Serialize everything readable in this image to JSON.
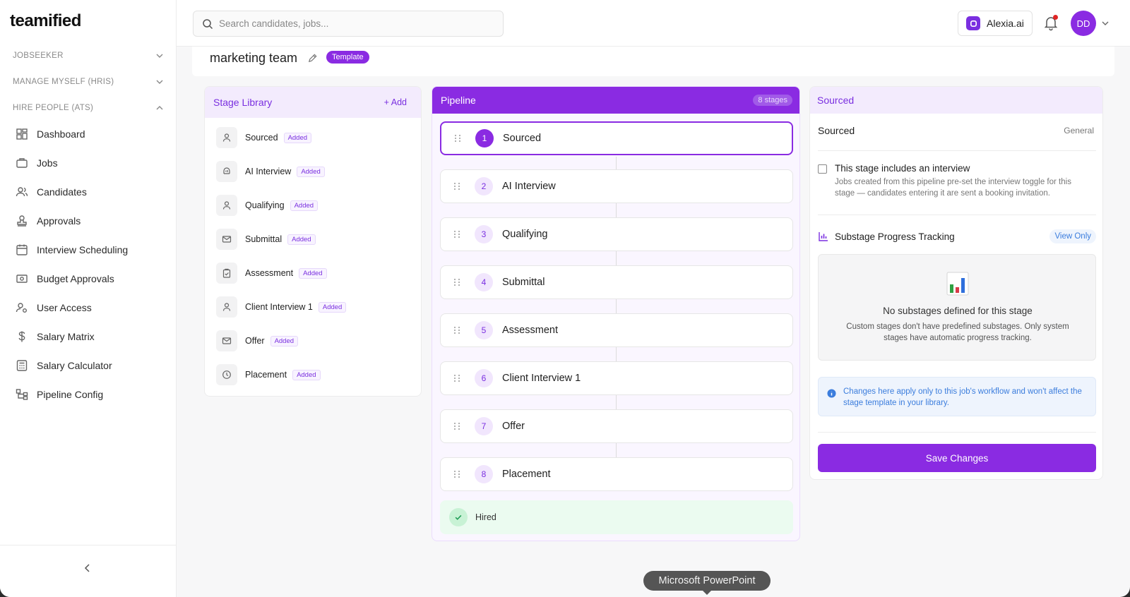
{
  "brand": {
    "name": "teamified"
  },
  "sidebar": {
    "sections": [
      {
        "label": "JOBSEEKER"
      },
      {
        "label": "MANAGE MYSELF (HRIS)"
      },
      {
        "label": "HIRE PEOPLE (ATS)"
      }
    ],
    "items": [
      {
        "label": "Dashboard",
        "icon": "dashboard-icon"
      },
      {
        "label": "Jobs",
        "icon": "briefcase-icon"
      },
      {
        "label": "Candidates",
        "icon": "users-icon"
      },
      {
        "label": "Approvals",
        "icon": "stamp-icon"
      },
      {
        "label": "Interview Scheduling",
        "icon": "calendar-icon"
      },
      {
        "label": "Budget Approvals",
        "icon": "money-icon"
      },
      {
        "label": "User Access",
        "icon": "user-gear-icon"
      },
      {
        "label": "Salary Matrix",
        "icon": "dollar-icon"
      },
      {
        "label": "Salary Calculator",
        "icon": "calculator-icon"
      },
      {
        "label": "Pipeline Config",
        "icon": "pipeline-icon"
      }
    ]
  },
  "header": {
    "search_placeholder": "Search candidates, jobs...",
    "assistant_label": "Alexia.ai",
    "avatar_initials": "DD"
  },
  "page": {
    "title": "marketing team",
    "badge": "Template"
  },
  "library": {
    "title": "Stage Library",
    "add_label": "+ Add",
    "items": [
      {
        "label": "Sourced",
        "status": "Added",
        "icon": "person-icon"
      },
      {
        "label": "AI Interview",
        "status": "Added",
        "icon": "ai-brain-icon"
      },
      {
        "label": "Qualifying",
        "status": "Added",
        "icon": "person-icon"
      },
      {
        "label": "Submittal",
        "status": "Added",
        "icon": "mail-icon"
      },
      {
        "label": "Assessment",
        "status": "Added",
        "icon": "clipboard-icon"
      },
      {
        "label": "Client Interview 1",
        "status": "Added",
        "icon": "person-icon"
      },
      {
        "label": "Offer",
        "status": "Added",
        "icon": "mail-icon"
      },
      {
        "label": "Placement",
        "status": "Added",
        "icon": "clock-icon"
      }
    ]
  },
  "pipeline": {
    "title": "Pipeline",
    "count_label": "8 stages",
    "stages": [
      {
        "num": "1",
        "label": "Sourced"
      },
      {
        "num": "2",
        "label": "AI Interview"
      },
      {
        "num": "3",
        "label": "Qualifying"
      },
      {
        "num": "4",
        "label": "Submittal"
      },
      {
        "num": "5",
        "label": "Assessment"
      },
      {
        "num": "6",
        "label": "Client Interview 1"
      },
      {
        "num": "7",
        "label": "Offer"
      },
      {
        "num": "8",
        "label": "Placement"
      }
    ],
    "final_label": "Hired"
  },
  "detail": {
    "header": "Sourced",
    "name": "Sourced",
    "type": "General",
    "interview_label": "This stage includes an interview",
    "interview_help": "Jobs created from this pipeline pre-set the interview toggle for this stage — candidates entering it are sent a booking invitation.",
    "substage_title": "Substage Progress Tracking",
    "view_only": "View Only",
    "empty_title": "No substages defined for this stage",
    "empty_desc": "Custom stages don't have predefined substages. Only system stages have automatic progress tracking.",
    "info_text": "Changes here apply only to this job's workflow and won't affect the stage template in your library.",
    "save_label": "Save Changes"
  },
  "tooltip": {
    "label": "Microsoft PowerPoint"
  },
  "colors": {
    "accent": "#8a2be2",
    "accent_light": "#f3ebfd",
    "info": "#3b7ddd",
    "success_bg": "#ebfbf0"
  }
}
